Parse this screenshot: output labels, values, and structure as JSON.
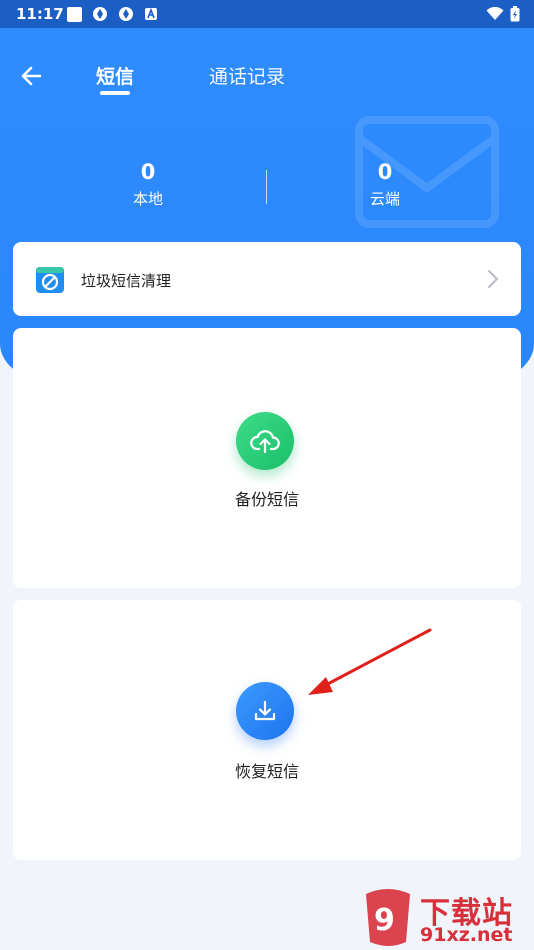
{
  "status_bar": {
    "time": "11:17"
  },
  "header": {
    "tabs": [
      {
        "label": "短信",
        "active": true
      },
      {
        "label": "通话记录",
        "active": false
      }
    ]
  },
  "stats": {
    "local": {
      "value": "0",
      "label": "本地"
    },
    "cloud": {
      "value": "0",
      "label": "云端"
    }
  },
  "junk_card": {
    "label": "垃圾短信清理"
  },
  "backup_card": {
    "label": "备份短信",
    "icon": "cloud-upload-icon"
  },
  "restore_card": {
    "label": "恢复短信",
    "icon": "download-icon"
  },
  "watermark": {
    "text": "下载站",
    "url": "91xz.net"
  },
  "colors": {
    "primary": "#2f8dff",
    "backup_green": "#1bc068",
    "restore_blue": "#1f74ef",
    "watermark_red": "#d8303b"
  }
}
